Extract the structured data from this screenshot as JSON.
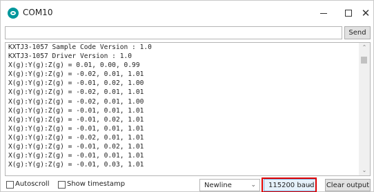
{
  "window": {
    "title": "COM10",
    "icon": "arduino-icon"
  },
  "send_row": {
    "input_value": "",
    "send_label": "Send"
  },
  "output": {
    "lines": [
      "KXTJ3-1057 Sample Code Version : 1.0",
      "KXTJ3-1057 Driver Version : 1.0",
      "X(g):Y(g):Z(g) = 0.01, 0.00, 0.99",
      "X(g):Y(g):Z(g) = -0.02, 0.01, 1.01",
      "X(g):Y(g):Z(g) = -0.01, 0.02, 1.00",
      "X(g):Y(g):Z(g) = -0.02, 0.01, 1.01",
      "X(g):Y(g):Z(g) = -0.02, 0.01, 1.00",
      "X(g):Y(g):Z(g) = -0.01, 0.01, 1.01",
      "X(g):Y(g):Z(g) = -0.01, 0.02, 1.01",
      "X(g):Y(g):Z(g) = -0.01, 0.01, 1.01",
      "X(g):Y(g):Z(g) = -0.02, 0.01, 1.01",
      "X(g):Y(g):Z(g) = -0.01, 0.02, 1.01",
      "X(g):Y(g):Z(g) = -0.01, 0.01, 1.01",
      "X(g):Y(g):Z(g) = -0.01, 0.03, 1.01"
    ]
  },
  "bottom": {
    "autoscroll_label": "Autoscroll",
    "autoscroll_checked": false,
    "timestamp_label": "Show timestamp",
    "timestamp_checked": false,
    "line_ending": "Newline",
    "baud_rate": "115200 baud",
    "clear_label": "Clear output"
  },
  "colors": {
    "highlight": "#e00000",
    "icon": "#00979c"
  }
}
